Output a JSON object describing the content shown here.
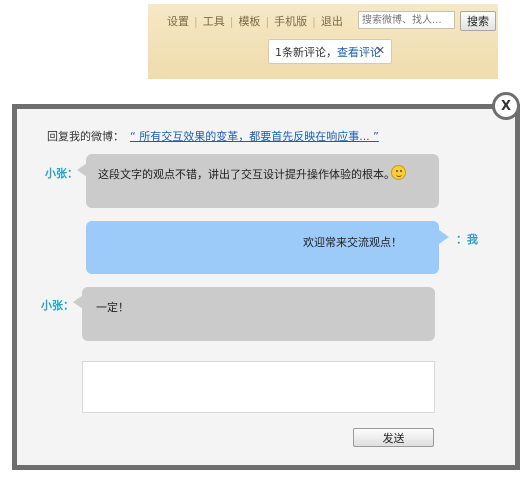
{
  "nav": {
    "links": [
      "设置",
      "工具",
      "模板",
      "手机版",
      "退出"
    ],
    "search_placeholder": "搜索微博、找人...",
    "search_button": "搜索"
  },
  "notification": {
    "text": "1条新评论，",
    "link": "查看评论",
    "close": "✕"
  },
  "dialog": {
    "close_label": "X",
    "reply_prefix": "回复我的微博：",
    "reply_quote": "“ 所有交互效果的变革，都要首先反映在响应事... ”",
    "messages": [
      {
        "sender": "小张：",
        "text": "这段文字的观点不错，讲出了交互设计提升操作体验的根本。",
        "emoticon": "smiley-icon"
      },
      {
        "sender": "：我",
        "text": "欢迎常来交流观点！"
      },
      {
        "sender": "小张：",
        "text": "一定！"
      }
    ],
    "reply_value": "",
    "send_label": "发送"
  },
  "colors": {
    "name_blue": "#2aa1c9",
    "link_blue": "#1a5eb0",
    "bubble_gray": "#cbcbcb",
    "bubble_blue": "#9ccbf9",
    "dialog_border": "#6e6e6e"
  }
}
